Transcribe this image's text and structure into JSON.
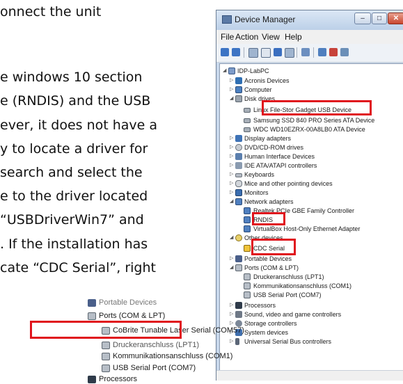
{
  "document": {
    "lines": [
      "onnect the unit",
      "",
      "e windows 10 section",
      "e (RNDIS) and the USB",
      "ever, it does not have a",
      "y to locate a driver for",
      "search and select the",
      "e to the driver located",
      "“USBDriverWin7” and",
      ". If the installation has",
      "cate “CDC Serial”, right"
    ]
  },
  "window": {
    "title": "Device Manager",
    "controls": {
      "minimize": "–",
      "maximize": "□",
      "close": "✕"
    },
    "menu": [
      "File",
      "Action",
      "View",
      "Help"
    ]
  },
  "tree": {
    "root": "IDP-LabPC",
    "items": [
      {
        "label": "Acronis Devices",
        "icon": "acronis-icon"
      },
      {
        "label": "Computer",
        "icon": "computer-icon"
      },
      {
        "label": "Disk drives",
        "icon": "disk-icon"
      },
      {
        "label": "Linux File-Stor Gadget USB Device",
        "icon": "disk-icon"
      },
      {
        "label": "Samsung SSD 840 PRO Series ATA Device",
        "icon": "disk-icon"
      },
      {
        "label": "WDC WD10EZRX-00A8LB0 ATA Device",
        "icon": "disk-icon"
      },
      {
        "label": "Display adapters",
        "icon": "display-icon"
      },
      {
        "label": "DVD/CD-ROM drives",
        "icon": "dvd-icon"
      },
      {
        "label": "Human Interface Devices",
        "icon": "hid-icon"
      },
      {
        "label": "IDE ATA/ATAPI controllers",
        "icon": "ide-icon"
      },
      {
        "label": "Keyboards",
        "icon": "keyboard-icon"
      },
      {
        "label": "Mice and other pointing devices",
        "icon": "mouse-icon"
      },
      {
        "label": "Monitors",
        "icon": "monitor-icon"
      },
      {
        "label": "Network adapters",
        "icon": "network-icon"
      },
      {
        "label": "Realtek PCIe GBE Family Controller",
        "icon": "network-icon"
      },
      {
        "label": "RNDIS",
        "icon": "network-icon"
      },
      {
        "label": "VirtualBox Host-Only Ethernet Adapter",
        "icon": "network-icon"
      },
      {
        "label": "Other devices",
        "icon": "unknown-device-icon"
      },
      {
        "label": "CDC Serial",
        "icon": "warning-device-icon"
      },
      {
        "label": "Portable Devices",
        "icon": "portable-icon"
      },
      {
        "label": "Ports (COM & LPT)",
        "icon": "port-icon"
      },
      {
        "label": "Druckeranschluss (LPT1)",
        "icon": "port-icon"
      },
      {
        "label": "Kommunikationsanschluss (COM1)",
        "icon": "port-icon"
      },
      {
        "label": "USB Serial Port (COM7)",
        "icon": "port-icon"
      },
      {
        "label": "Processors",
        "icon": "processor-icon"
      },
      {
        "label": "Sound, video and game controllers",
        "icon": "sound-icon"
      },
      {
        "label": "Storage controllers",
        "icon": "storage-icon"
      },
      {
        "label": "System devices",
        "icon": "system-icon"
      },
      {
        "label": "Universal Serial Bus controllers",
        "icon": "usb-icon"
      }
    ]
  },
  "inset": {
    "items": [
      {
        "label": "Portable Devices"
      },
      {
        "label": "Ports (COM & LPT)"
      },
      {
        "label": "CoBrite Tunable Laser Serial (COM57)"
      },
      {
        "label": "Druckeranschluss (LPT1)"
      },
      {
        "label": "Kommunikationsanschluss (COM1)"
      },
      {
        "label": "USB Serial Port (COM7)"
      },
      {
        "label": "Processors"
      }
    ]
  },
  "colors": {
    "highlight": "#e0141d"
  }
}
